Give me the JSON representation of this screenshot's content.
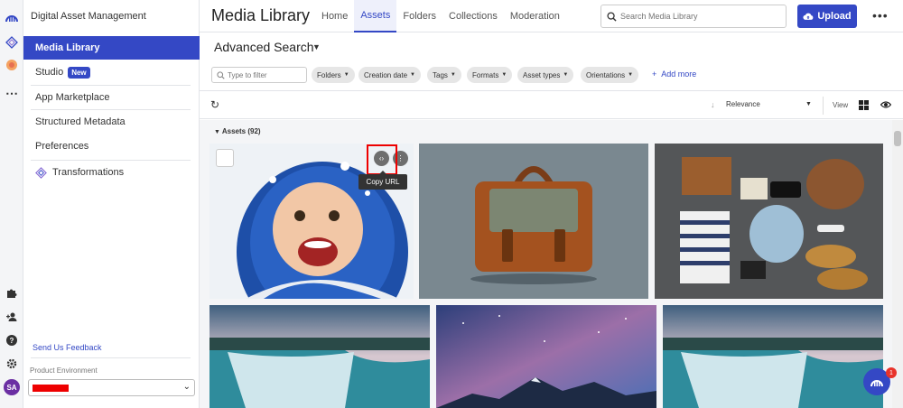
{
  "app": {
    "name": "Digital Asset Management"
  },
  "sidebar": {
    "items": [
      {
        "label": "Media Library"
      },
      {
        "label": "Studio",
        "badge": "New"
      },
      {
        "label": "App Marketplace"
      },
      {
        "label": "Structured Metadata"
      },
      {
        "label": "Preferences"
      },
      {
        "label": "Transformations"
      }
    ],
    "feedback": "Send Us Feedback",
    "env_label": "Product Environment"
  },
  "rail": {
    "avatar": "SA"
  },
  "header": {
    "title": "Media Library",
    "tabs": [
      "Home",
      "Assets",
      "Folders",
      "Collections",
      "Moderation"
    ],
    "active_tab": "Assets",
    "search_placeholder": "Search Media Library",
    "upload_label": "Upload"
  },
  "advanced_search": {
    "label": "Advanced Search"
  },
  "filters": {
    "placeholder": "Type to filter",
    "chips": [
      "Folders",
      "Creation date",
      "Tags",
      "Formats",
      "Asset types",
      "Orientations"
    ],
    "add_more": "Add more"
  },
  "toolbar": {
    "sort": "Relevance",
    "view_label": "View"
  },
  "assets": {
    "heading": "Assets (92)",
    "tooltip": "Copy URL",
    "items": [
      {
        "subject": "child-in-snow"
      },
      {
        "subject": "leather-bag"
      },
      {
        "subject": "travel-flatlay"
      },
      {
        "subject": "waterfall"
      },
      {
        "subject": "mountain-night-sky"
      },
      {
        "subject": "waterfall"
      }
    ]
  },
  "chat": {
    "count": "1"
  },
  "colors": {
    "accent": "#3448c5",
    "alert": "#e8332b"
  }
}
